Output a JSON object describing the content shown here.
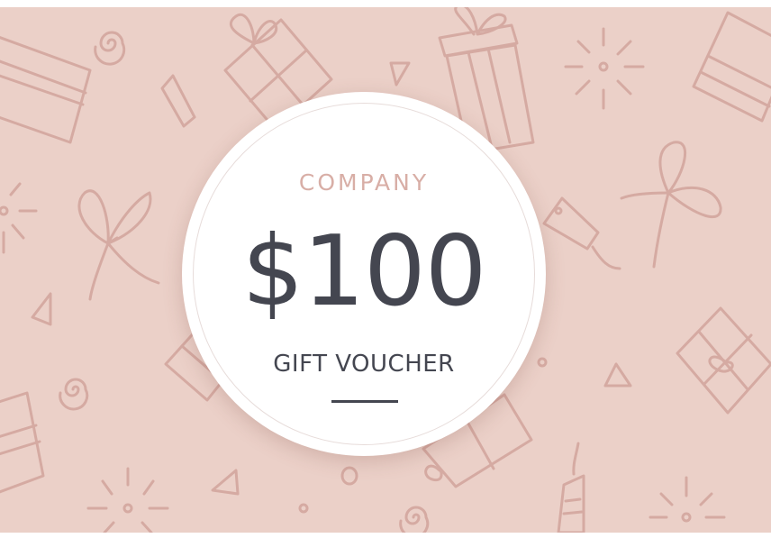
{
  "voucher": {
    "company": "COMPANY",
    "amount": "$100",
    "subtitle": "GIFT VOUCHER"
  },
  "colors": {
    "background": "#ebd0c8",
    "pattern_stroke": "#d5aaa2",
    "badge": "#ffffff",
    "company_text": "#d8aea6",
    "amount_text": "#444650",
    "subtitle_text": "#444650",
    "rule": "#444650"
  },
  "icons": [
    "gift-box-icon",
    "bow-icon",
    "gift-tag-icon",
    "spiral-icon",
    "sparkle-icon",
    "triangle-confetti-icon",
    "circle-confetti-icon"
  ]
}
